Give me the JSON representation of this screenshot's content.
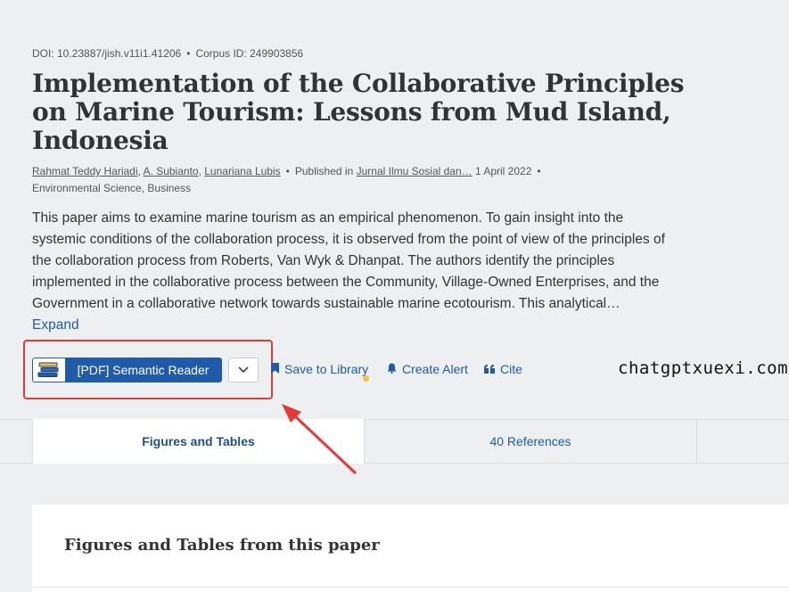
{
  "paper": {
    "doi": "DOI: 10.23887/jish.v11i1.41206",
    "corpus_id": "Corpus ID: 249903856",
    "title": "Implementation of the Collaborative Principles on Marine Tourism: Lessons from Mud Island, Indonesia",
    "authors": [
      "Rahmat Teddy Hariadi",
      "A. Subianto",
      "Lunariana Lubis"
    ],
    "published_prefix": "Published in",
    "journal": "Jurnal Ilmu Sosial dan…",
    "date": "1 April 2022",
    "fields": "Environmental Science, Business",
    "abstract": "This paper aims to examine marine tourism as an empirical phenomenon. To gain insight into the systemic conditions of the collaboration process, it is observed from the point of view of the principles of the collaboration process from Roberts, Van Wyk & Dhanpat. The authors identify the principles implemented in the collaborative process between the Community, Village-Owned Enterprises, and the Government in a collaborative network towards sustainable marine ecotourism. This analytical…",
    "expand_label": "Expand"
  },
  "actions": {
    "reader_label": "[PDF] Semantic Reader",
    "save_label": "Save to Library",
    "alert_label": "Create Alert",
    "cite_label": "Cite"
  },
  "watermark": "chatgptxuexi.com",
  "tabs": [
    {
      "label": "Figures and Tables",
      "active": true
    },
    {
      "label": "40 References",
      "active": false
    }
  ],
  "section": {
    "title": "Figures and Tables from this paper"
  },
  "colors": {
    "link": "#1f5ba8",
    "highlight": "#e53935",
    "background": "#eeeff1"
  }
}
